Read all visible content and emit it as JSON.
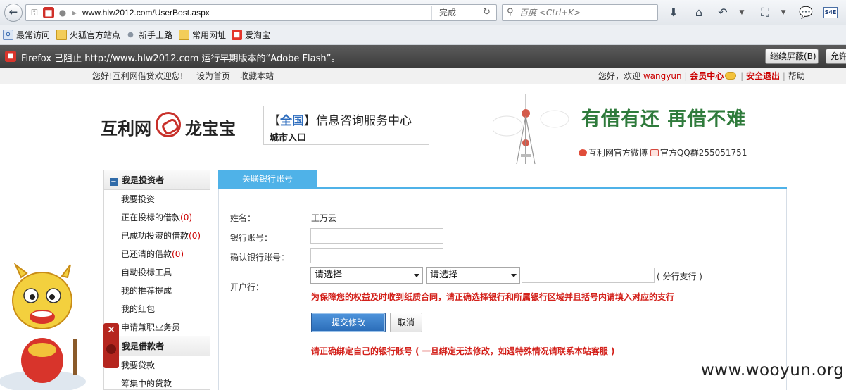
{
  "browser": {
    "url": "www.hlw2012.com/UserBost.aspx",
    "load_status": "完成",
    "search_placeholder": "百度 <Ctrl+K>",
    "toolbar_badge": "S4E",
    "bookmarks": [
      "最常访问",
      "火狐官方站点",
      "新手上路",
      "常用网址",
      "爱淘宝"
    ],
    "notification": {
      "text": "Firefox 已阻止 http://www.hlw2012.com 运行早期版本的“Adobe Flash”。",
      "continue_label": "继续屏蔽(B)",
      "allow_label": "允许"
    }
  },
  "site": {
    "topbar": {
      "greeting": "您好!互利网借贷欢迎您!",
      "set_home": "设为首页",
      "bookmark": "收藏本站",
      "welcome_prefix": "您好，欢迎",
      "username": "wangyun",
      "member_center": "会员中心",
      "logout": "安全退出",
      "help": "帮助"
    },
    "header": {
      "logo_left": "互利网",
      "logo_right": "龙宝宝",
      "info_title_open": "【",
      "info_title_region": "全国",
      "info_title_close": "】信息咨询服务中心",
      "info_sub": "城市入口",
      "slogan": "有借有还 再借不难",
      "weibo": "互利网官方微博",
      "qq_group": "官方QQ群255051751"
    },
    "sidebar": {
      "investor_title": "我是投资者",
      "investor_items": [
        {
          "label": "我要投资",
          "count": ""
        },
        {
          "label": "正在投标的借款",
          "count": "(0)"
        },
        {
          "label": "已成功投资的借款",
          "count": "(0)"
        },
        {
          "label": "已还清的借款",
          "count": "(0)"
        },
        {
          "label": "自动投标工具",
          "count": ""
        },
        {
          "label": "我的推荐提成",
          "count": ""
        },
        {
          "label": "我的红包",
          "count": ""
        },
        {
          "label": "申请兼职业务员",
          "count": ""
        }
      ],
      "borrower_title": "我是借款者",
      "borrower_items": [
        {
          "label": "我要贷款",
          "count": ""
        },
        {
          "label": "筹集中的贷款",
          "count": ""
        }
      ]
    },
    "form": {
      "tab": "关联银行账号",
      "name_label": "姓名：",
      "name_value": "王万云",
      "account_label": "银行账号：",
      "confirm_label": "确认银行账号：",
      "branch_label": "开户行：",
      "bank_select": "请选择",
      "region_select": "请选择",
      "branch_suffix": "( 分行支行 )",
      "warning": "为保障您的权益及时收到纸质合同，请正确选择银行和所属银行区域并且括号内请填入对应的支行",
      "submit": "提交修改",
      "cancel": "取消",
      "notice": "请正确绑定自己的银行账号 ( 一旦绑定无法修改，如遇特殊情况请联系本站客服 )"
    }
  },
  "watermark": "www.wooyun.org",
  "colors": {
    "accent": "#4fb2e8",
    "warning": "#d3201a",
    "slogan": "#2f7b3c"
  }
}
